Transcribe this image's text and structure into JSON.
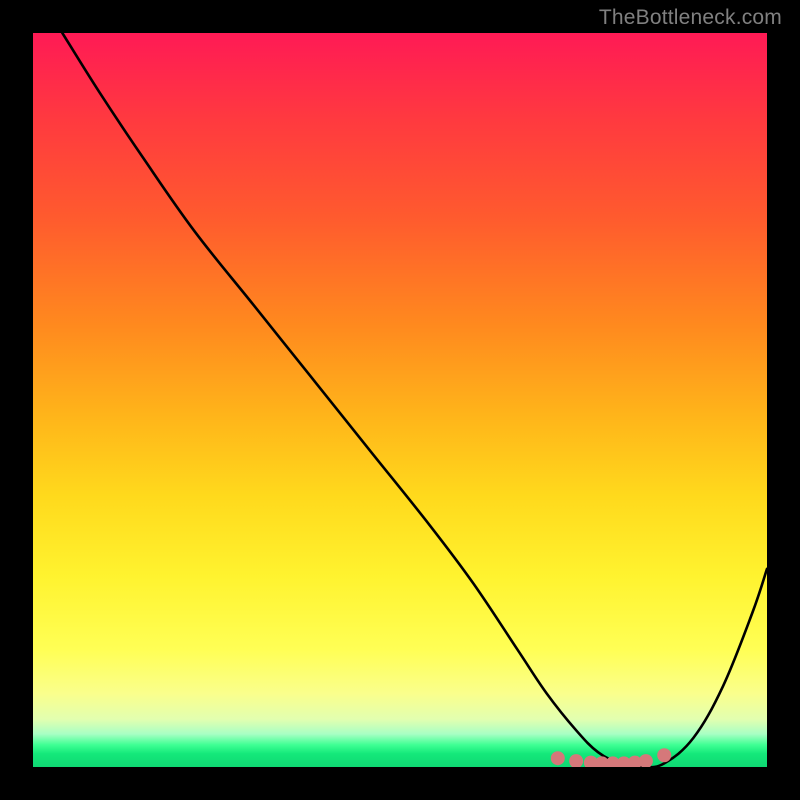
{
  "attribution": "TheBottleneck.com",
  "chart_data": {
    "type": "line",
    "title": "",
    "xlabel": "",
    "ylabel": "",
    "xlim": [
      0,
      100
    ],
    "ylim": [
      0,
      100
    ],
    "grid": false,
    "legend": false,
    "series": [
      {
        "name": "bottleneck-curve",
        "x": [
          4,
          9,
          15,
          22,
          30,
          38,
          46,
          54,
          60,
          66,
          70,
          74,
          77,
          80,
          83,
          86,
          90,
          94,
          98,
          100
        ],
        "values": [
          100,
          92,
          83,
          73,
          63,
          53,
          43,
          33,
          25,
          16,
          10,
          5,
          2,
          0.5,
          0,
          0.5,
          4,
          11,
          21,
          27
        ]
      }
    ],
    "markers": {
      "name": "bottleneck-minimum-dots",
      "x": [
        71.5,
        74.0,
        76.0,
        77.5,
        79.0,
        80.5,
        82.0,
        83.5,
        86.0
      ],
      "values": [
        1.2,
        0.8,
        0.6,
        0.5,
        0.5,
        0.5,
        0.6,
        0.8,
        1.6
      ],
      "color": "#d5787a",
      "radius": 7
    },
    "background_gradient": {
      "direction": "vertical",
      "stops": [
        {
          "pos": 0.0,
          "color": "#ff1a55"
        },
        {
          "pos": 0.25,
          "color": "#ff5a2e"
        },
        {
          "pos": 0.52,
          "color": "#ffb41a"
        },
        {
          "pos": 0.74,
          "color": "#fff32f"
        },
        {
          "pos": 0.9,
          "color": "#faff8c"
        },
        {
          "pos": 0.97,
          "color": "#3eff93"
        },
        {
          "pos": 1.0,
          "color": "#0fd873"
        }
      ]
    }
  }
}
